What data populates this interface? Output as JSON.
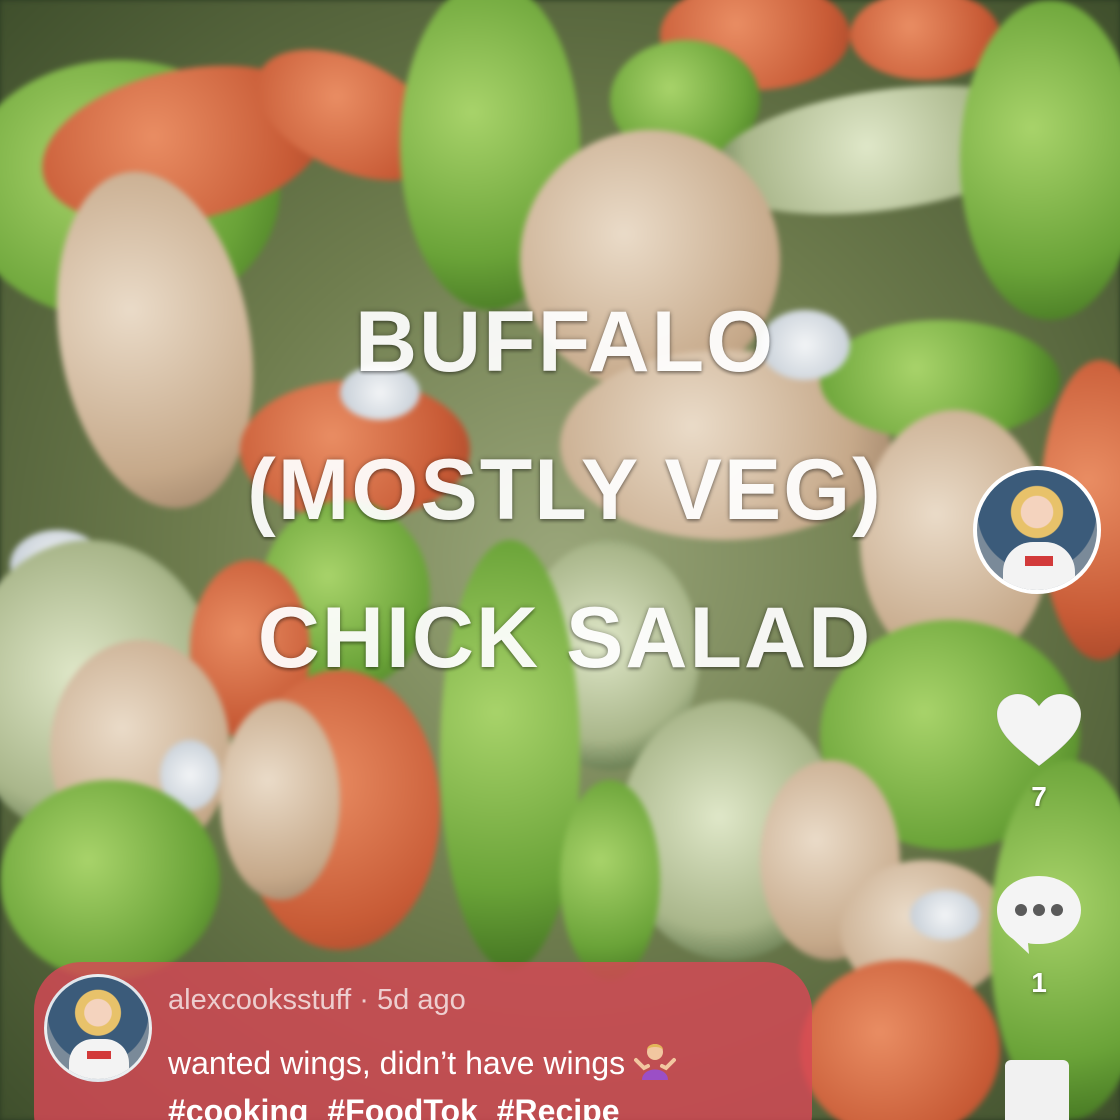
{
  "video": {
    "title_lines": [
      "BUFFALO",
      "(MOSTLY VEG)",
      "CHICK SALAD"
    ]
  },
  "rail": {
    "profile_icon": "creator-avatar",
    "like_icon": "heart-icon",
    "like_count": "7",
    "comment_icon": "comment-bubble-icon",
    "comment_count": "1",
    "bookmark_icon": "bookmark-icon"
  },
  "caption": {
    "username": "alexcooksstuff",
    "separator": " · ",
    "time_ago": "5d ago",
    "text": "wanted wings, didn’t have wings",
    "emoji_icon": "person-shrugging-emoji",
    "hashtags": [
      "#cooking",
      "#FoodTok",
      "#Recipe"
    ]
  },
  "colors": {
    "caption_bg": "#d64856",
    "text": "#ffffff"
  }
}
